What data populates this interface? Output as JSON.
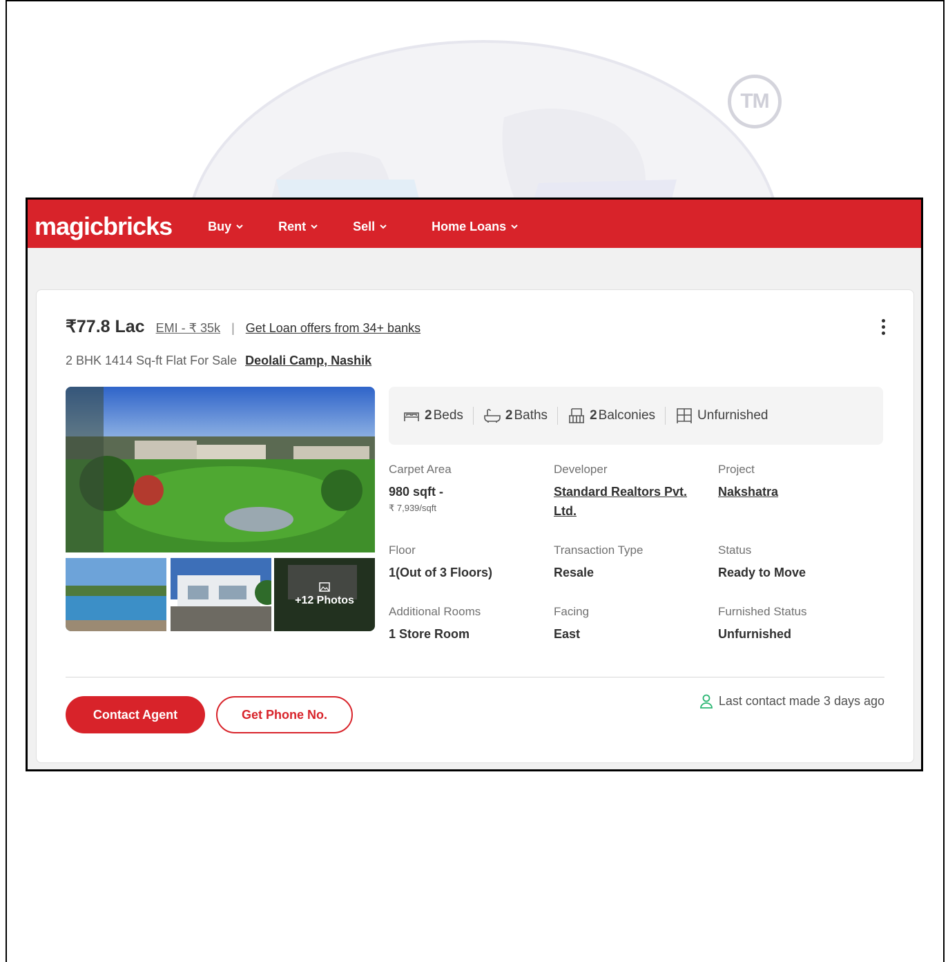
{
  "header": {
    "logo": "magicbricks",
    "nav": [
      {
        "label": "Buy"
      },
      {
        "label": "Rent"
      },
      {
        "label": "Sell"
      },
      {
        "label": "Home Loans"
      }
    ]
  },
  "listing": {
    "price": "₹77.8 Lac",
    "emi": "EMI - ₹ 35k",
    "separator": "|",
    "loan_offer": "Get Loan offers from 34+ banks",
    "subtitle": "2 BHK 1414 Sq-ft Flat For Sale",
    "locality": "Deolali Camp, Nashik",
    "photos_more": "+12 Photos",
    "amenities": [
      {
        "count": "2",
        "label": "Beds",
        "icon": "bed-icon"
      },
      {
        "count": "2",
        "label": "Baths",
        "icon": "bath-icon"
      },
      {
        "count": "2",
        "label": "Balconies",
        "icon": "balcony-icon"
      },
      {
        "count": "",
        "label": "Unfurnished",
        "icon": "furniture-icon"
      }
    ],
    "summary": {
      "carpet_area": {
        "label": "Carpet Area",
        "value": "980 sqft -",
        "sub": "₹ 7,939/sqft"
      },
      "developer": {
        "label": "Developer",
        "value": "Standard Realtors Pvt. Ltd."
      },
      "project": {
        "label": "Project",
        "value": "Nakshatra"
      },
      "floor": {
        "label": "Floor",
        "value": "1(Out of 3 Floors)"
      },
      "transaction": {
        "label": "Transaction Type",
        "value": "Resale"
      },
      "status": {
        "label": "Status",
        "value": "Ready to Move"
      },
      "additional_rooms": {
        "label": "Additional Rooms",
        "value": "1 Store Room"
      },
      "facing": {
        "label": "Facing",
        "value": "East"
      },
      "furnished": {
        "label": "Furnished Status",
        "value": "Unfurnished"
      }
    },
    "actions": {
      "contact_agent": "Contact Agent",
      "get_phone": "Get Phone No."
    },
    "last_contact": "Last contact made 3 days ago"
  },
  "watermark": {
    "tm": "TM"
  },
  "colors": {
    "brand": "#d8232a",
    "text": "#303030",
    "muted": "#707070",
    "contact_icon": "#2bb673"
  }
}
